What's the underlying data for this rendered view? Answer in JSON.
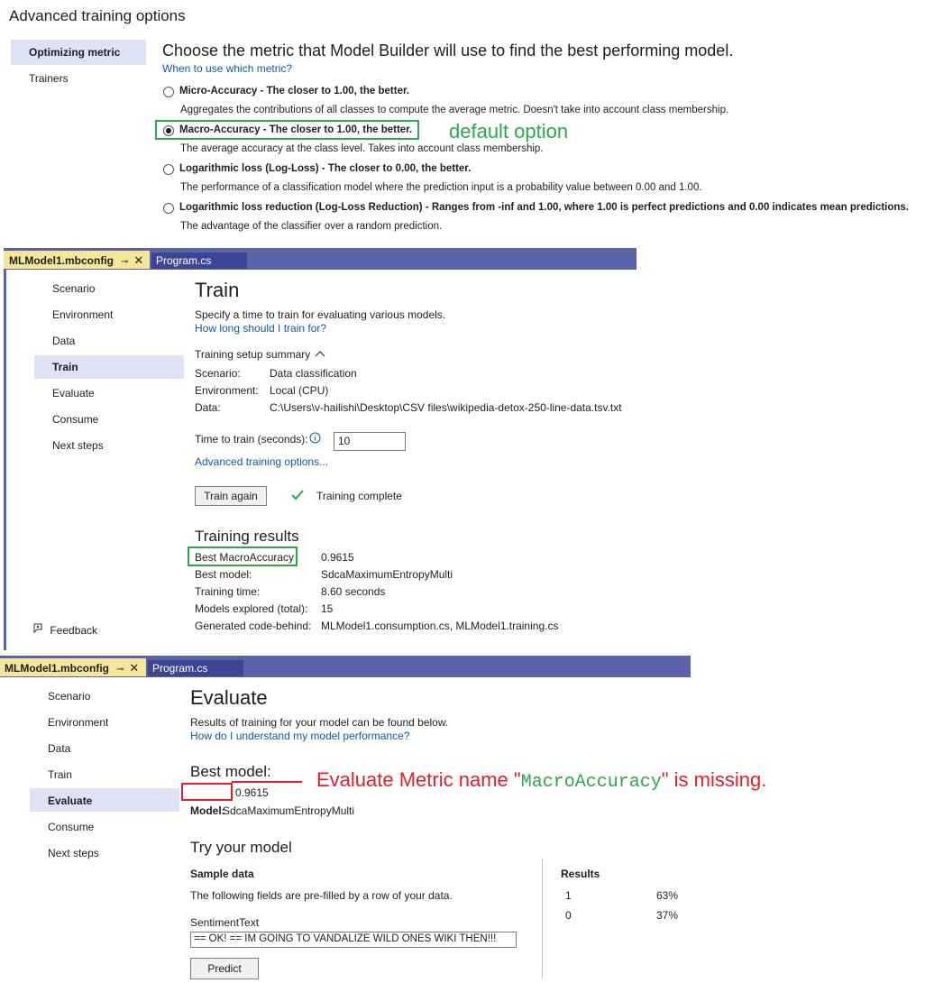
{
  "section1": {
    "title": "Advanced training options",
    "nav": {
      "optimizing_metric": "Optimizing metric",
      "trainers": "Trainers"
    },
    "heading": "Choose the metric that Model Builder will use to find the best performing model.",
    "link": "When to use which metric?",
    "options": [
      {
        "label": "Micro-Accuracy - The closer to 1.00, the better.",
        "desc": "Aggregates the contributions of all classes to compute the average metric. Doesn't take into account class membership.",
        "selected": false
      },
      {
        "label": "Macro-Accuracy - The closer to 1.00, the better.",
        "desc": "The average accuracy at the class level. Takes into account class membership.",
        "selected": true
      },
      {
        "label": "Logarithmic loss (Log-Loss) - The closer to 0.00, the better.",
        "desc": "The performance of a classification model where the prediction input is a probability value between 0.00 and 1.00.",
        "selected": false
      },
      {
        "label": "Logarithmic loss reduction (Log-Loss Reduction) - Ranges from -inf and 1.00, where 1.00 is perfect predictions and 0.00 indicates mean predictions.",
        "desc": "The advantage of the classifier over a random prediction.",
        "selected": false
      }
    ],
    "annotation": "default option"
  },
  "section2": {
    "tabs": {
      "active": "MLModel1.mbconfig",
      "pin": "⊸",
      "close": "✕",
      "inactive": "Program.cs"
    },
    "nav": [
      "Scenario",
      "Environment",
      "Data",
      "Train",
      "Evaluate",
      "Consume",
      "Next steps"
    ],
    "selected_nav": "Train",
    "feedback": "Feedback",
    "title": "Train",
    "desc": "Specify a time to train for evaluating various models.",
    "link": "How long should I train for?",
    "summary_label": "Training setup summary",
    "summary": [
      {
        "key": "Scenario:",
        "value": "Data classification"
      },
      {
        "key": "Environment:",
        "value": "Local (CPU)"
      },
      {
        "key": "Data:",
        "value": "C:\\Users\\v-hailishi\\Desktop\\CSV files\\wikipedia-detox-250-line-data.tsv.txt"
      }
    ],
    "time_label": "Time to train (seconds):",
    "time_value": "10",
    "advanced_link": "Advanced training options...",
    "train_again": "Train again",
    "status": "Training complete",
    "results_title": "Training results",
    "results": [
      {
        "key": "Best MacroAccuracy",
        "value": "0.9615"
      },
      {
        "key": "Best model:",
        "value": "SdcaMaximumEntropyMulti"
      },
      {
        "key": "Training time:",
        "value": "8.60 seconds"
      },
      {
        "key": "Models explored (total):",
        "value": "15"
      },
      {
        "key": "Generated code-behind:",
        "value": "MLModel1.consumption.cs, MLModel1.training.cs"
      }
    ]
  },
  "section3": {
    "tabs": {
      "active": "MLModel1.mbconfig",
      "pin": "⊸",
      "close": "✕",
      "inactive": "Program.cs"
    },
    "nav": [
      "Scenario",
      "Environment",
      "Data",
      "Train",
      "Evaluate",
      "Consume",
      "Next steps"
    ],
    "selected_nav": "Evaluate",
    "title": "Evaluate",
    "desc": "Results of training for your model can be found below.",
    "link": "How do I understand my model performance?",
    "best_model_title": "Best model:",
    "metric_value": "0.9615",
    "model_key": "Model:",
    "model_value": "SdcaMaximumEntropyMulti",
    "annotation_prefix": "Evaluate Metric name \"",
    "annotation_code": "MacroAccuracy",
    "annotation_suffix": "\" is missing.",
    "try_title": "Try your model",
    "sample_data": "Sample data",
    "sample_desc": "The following fields are pre-filled by a row of your data.",
    "field_label": "SentimentText",
    "field_value": "== OK! ==  IM GOING TO VANDALIZE WILD ONES WIKI THEN!!!",
    "predict": "Predict",
    "results_title": "Results",
    "results": [
      {
        "label": "1",
        "value": "63%"
      },
      {
        "label": "0",
        "value": "37%"
      }
    ]
  },
  "colors": {
    "accent_green": "#2aa84a",
    "annotation_red": "#e0202a",
    "link": "#0e5aa7",
    "tab_bar": "#5a63a8",
    "tab_active": "#f4e79a"
  }
}
